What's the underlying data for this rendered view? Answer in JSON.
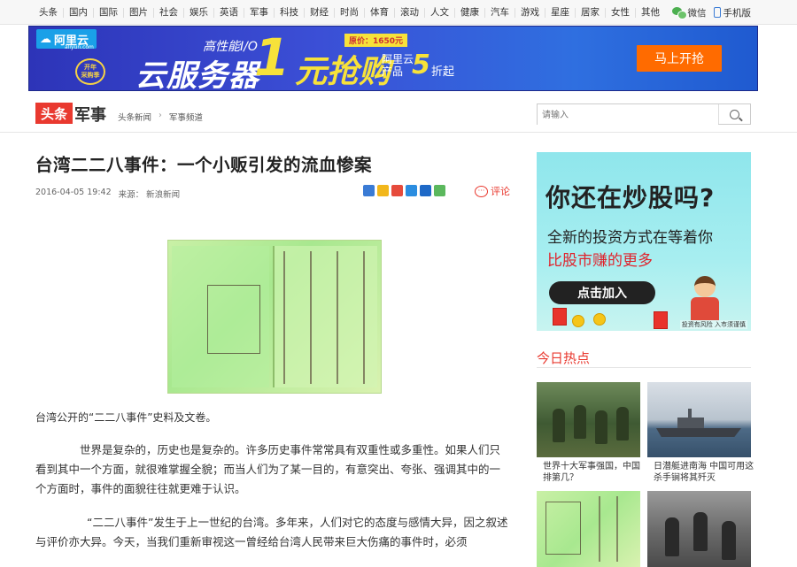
{
  "nav": {
    "items": [
      "头条",
      "国内",
      "国际",
      "图片",
      "社会",
      "娱乐",
      "英语",
      "军事",
      "科技",
      "财经",
      "时尚",
      "体育",
      "滚动",
      "人文",
      "健康",
      "汽车",
      "游戏",
      "星座",
      "居家",
      "女性",
      "其他"
    ],
    "wechat": "微信",
    "mobile": "手机版"
  },
  "banner": {
    "brand": "阿里云",
    "brand_domain": "aliyun.com",
    "badge_line1": "开年",
    "badge_line2": "采购季",
    "sub_headline": "高性能I/O",
    "headline": "云服务器",
    "big_number": "1",
    "buy_text": "元抢购",
    "original_price": "原价：1650元",
    "product_line1": "阿里云",
    "product_line2": "产品",
    "discount": "5",
    "discount_suffix": "折起",
    "cta": "马上开抢"
  },
  "header": {
    "logo": "头条",
    "category": "军事",
    "crumbs": [
      "头条新闻",
      "军事频道"
    ],
    "search_placeholder": "请输入"
  },
  "article": {
    "title": "台湾二二八事件：一个小贩引发的流血惨案",
    "date": "2016-04-05 19:42",
    "source": "来源： 新浪新闻",
    "comment": "评论",
    "caption": "台湾公开的“二二八事件”史料及文卷。",
    "para1": "世界是复杂的，历史也是复杂的。许多历史事件常常具有双重性或多重性。如果人们只看到其中一个方面，就很难掌握全貌；而当人们为了某一目的，有意突出、夸张、强调其中的一个方面时，事件的面貌往往就更难于认识。",
    "para2": "“二二八事件”发生于上一世纪的台湾。多年来，人们对它的态度与感情大异，因之叙述与评价亦大异。今天，当我们重新审视这一曾经给台湾人民带来巨大伤痛的事件时，必须"
  },
  "sidebar": {
    "ad_question": "你还在炒股吗?",
    "ad_line2": "全新的投资方式在等着你",
    "ad_line3": "比股市赚的更多",
    "ad_button": "点击加入",
    "ad_note": "投资有风险 入市须谨慎",
    "hot_title": "今日热点",
    "hot_items": [
      {
        "caption": "世界十大军事强国，中国排第几？"
      },
      {
        "caption": "日潜艇进南海 中国可用这杀手锏将其歼灭"
      },
      {
        "caption": ""
      },
      {
        "caption": ""
      }
    ]
  },
  "colors": {
    "accent": "#e9392f",
    "banner_blue": "#2d34b8",
    "cta_orange": "#ff6b00"
  }
}
